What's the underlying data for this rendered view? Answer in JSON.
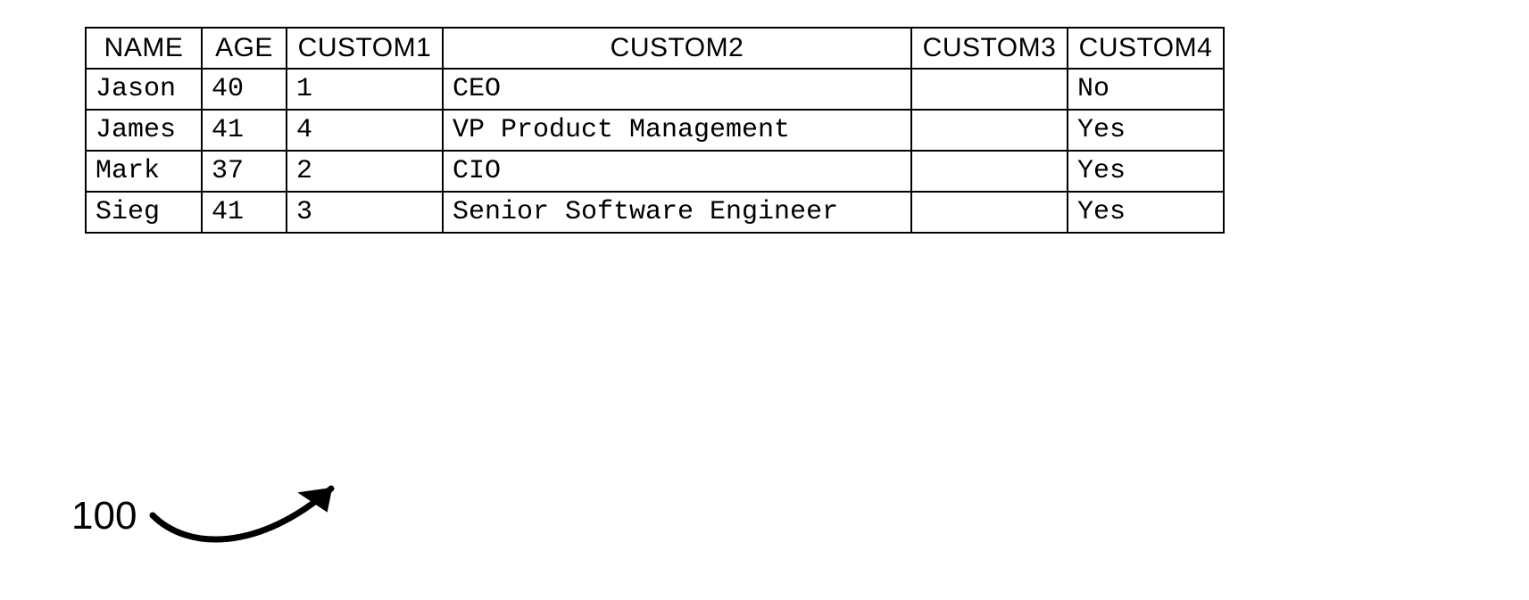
{
  "table": {
    "headers": [
      "NAME",
      "AGE",
      "CUSTOM1",
      "CUSTOM2",
      "CUSTOM3",
      "CUSTOM4"
    ],
    "rows": [
      {
        "name": "Jason",
        "age": "40",
        "custom1": "1",
        "custom2": "CEO",
        "custom3": "",
        "custom4": "No"
      },
      {
        "name": "James",
        "age": "41",
        "custom1": "4",
        "custom2": "VP Product Management",
        "custom3": "",
        "custom4": "Yes"
      },
      {
        "name": "Mark",
        "age": "37",
        "custom1": "2",
        "custom2": "CIO",
        "custom3": "",
        "custom4": "Yes"
      },
      {
        "name": "Sieg",
        "age": "41",
        "custom1": "3",
        "custom2": "Senior Software Engineer",
        "custom3": "",
        "custom4": "Yes"
      }
    ]
  },
  "reference_label": "100"
}
